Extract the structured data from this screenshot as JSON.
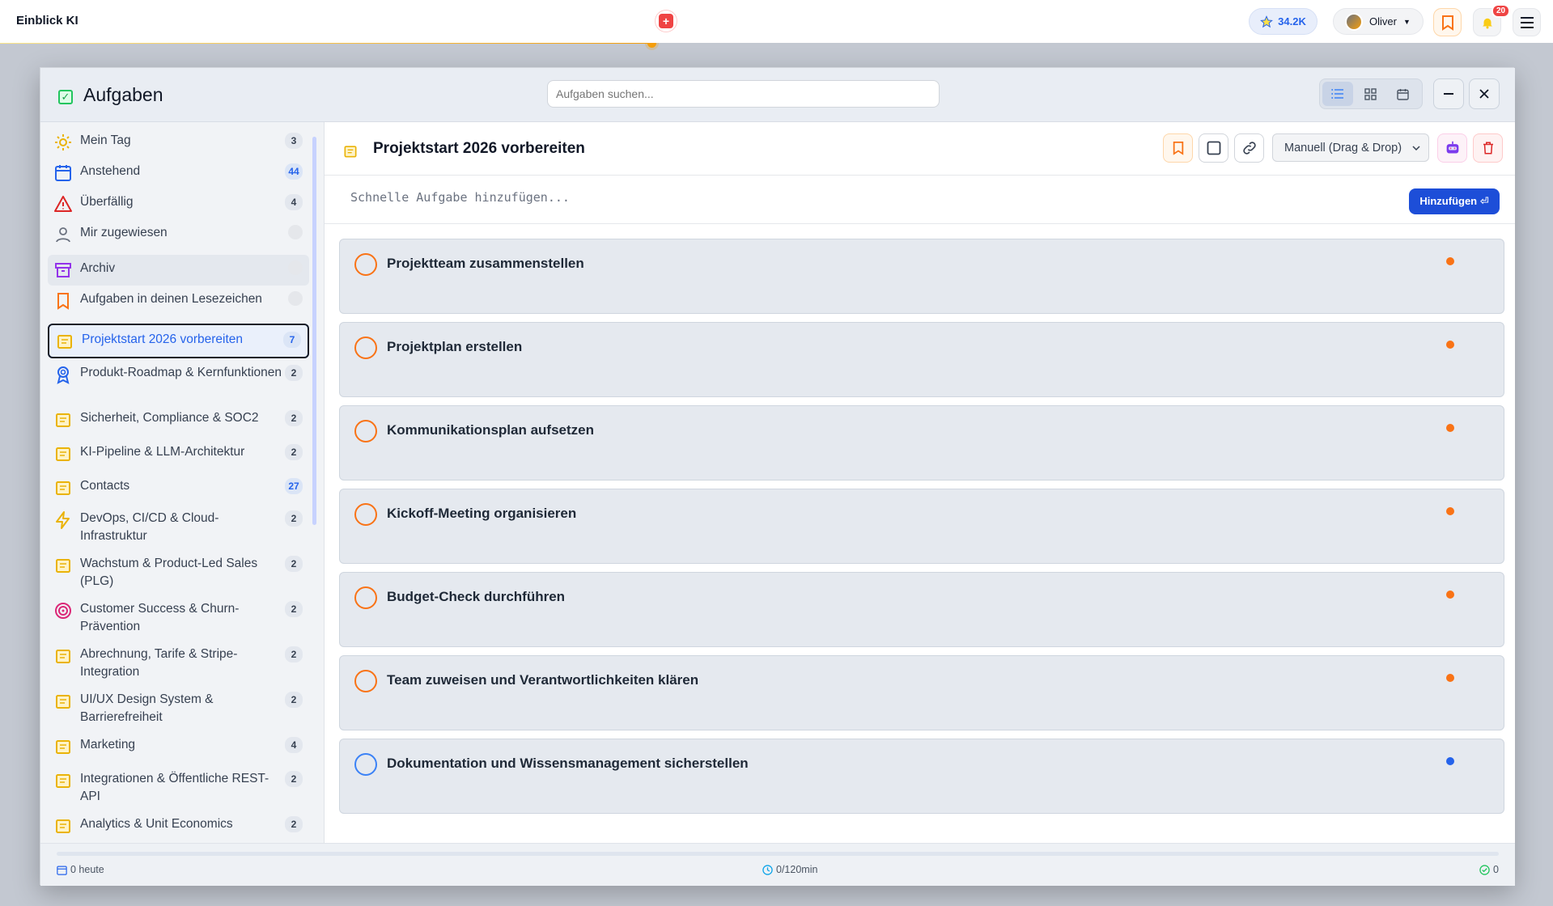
{
  "app": {
    "title": "Einblick KI"
  },
  "topbar": {
    "credits": "34.2K",
    "user_name": "Oliver",
    "notifications_count": "20",
    "icons": {
      "credits": "star-icon",
      "bookmark": "bookmark-icon",
      "notifications": "bell-icon",
      "menu": "hamburger-icon",
      "center": "swiss-logo-icon"
    },
    "accent": "#f59e0b"
  },
  "modal": {
    "title": "Aufgaben",
    "search_placeholder": "Aufgaben suchen...",
    "views": [
      "list-view-icon",
      "grid-view-icon",
      "calendar-view-icon"
    ],
    "active_view": "list"
  },
  "sidebar": {
    "smart_lists": [
      {
        "label": "Mein Tag",
        "count": "3",
        "icon": "sun-icon"
      },
      {
        "label": "Anstehend",
        "count": "44",
        "icon": "calendar-icon"
      },
      {
        "label": "Überfällig",
        "count": "4",
        "icon": "warning-icon"
      },
      {
        "label": "Mir zugewiesen",
        "count": "",
        "icon": "user-icon"
      },
      {
        "label": "Archiv",
        "count": "",
        "icon": "archive-icon"
      },
      {
        "label": "Aufgaben in deinen Lesezeichen",
        "count": "",
        "icon": "bookmark-icon"
      }
    ],
    "projects": [
      {
        "label": "Projektstart 2026 vorbereiten",
        "count": "7",
        "icon": "folder-icon",
        "active": true
      },
      {
        "label": "Produkt-Roadmap & Kernfunktionen",
        "count": "2",
        "icon": "award-icon"
      },
      {
        "label": "Sicherheit, Compliance & SOC2",
        "count": "2",
        "icon": "folder-icon"
      },
      {
        "label": "KI-Pipeline & LLM-Architektur",
        "count": "2",
        "icon": "folder-icon"
      },
      {
        "label": "Contacts",
        "count": "27",
        "icon": "folder-icon"
      },
      {
        "label": "DevOps, CI/CD & Cloud-Infrastruktur",
        "count": "2",
        "icon": "lightning-icon"
      },
      {
        "label": "Wachstum & Product-Led Sales (PLG)",
        "count": "2",
        "icon": "folder-icon"
      },
      {
        "label": "Customer Success & Churn-Prävention",
        "count": "2",
        "icon": "target-icon"
      },
      {
        "label": "Abrechnung, Tarife & Stripe-Integration",
        "count": "2",
        "icon": "folder-icon"
      },
      {
        "label": "UI/UX Design System & Barrierefreiheit",
        "count": "2",
        "icon": "folder-icon"
      },
      {
        "label": "Marketing",
        "count": "4",
        "icon": "folder-icon"
      },
      {
        "label": "Integrationen & Öffentliche REST-API",
        "count": "2",
        "icon": "folder-icon"
      },
      {
        "label": "Analytics & Unit Economics",
        "count": "2",
        "icon": "folder-icon"
      }
    ]
  },
  "main": {
    "list_title": "Projektstart 2026 vorbereiten",
    "sort_value": "Manuell (Drag & Drop)",
    "quick_add_placeholder": "Schnelle Aufgabe hinzufügen...",
    "add_button": "Hinzufügen ⏎",
    "tasks": [
      {
        "title": "Projektteam zusammenstellen",
        "priority_color": "#f97316"
      },
      {
        "title": "Projektplan erstellen",
        "priority_color": "#f97316"
      },
      {
        "title": "Kommunikationsplan aufsetzen",
        "priority_color": "#f97316"
      },
      {
        "title": "Kickoff-Meeting organisieren",
        "priority_color": "#f97316"
      },
      {
        "title": "Budget-Check durchführen",
        "priority_color": "#f97316"
      },
      {
        "title": "Team zuweisen und Verantwortlichkeiten klären",
        "priority_color": "#f97316"
      },
      {
        "title": "Dokumentation und Wissensmanagement sicherstellen",
        "priority_color": "#2563eb"
      }
    ]
  },
  "footer": {
    "today": "0 heute",
    "time": "0/120min",
    "done": "0"
  }
}
